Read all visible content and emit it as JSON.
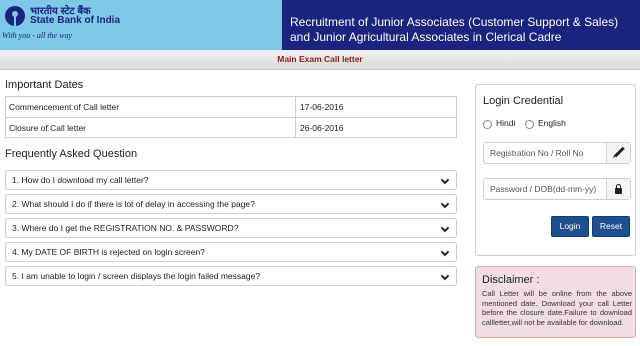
{
  "header": {
    "logo_hindi": "भारतीय स्टेट बैंक",
    "logo_english": "State Bank of India",
    "logo_tagline": "With you - all the way",
    "title": "Recruitment of Junior Associates (Customer Support & Sales) and Junior Agricultural Associates in Clerical Cadre"
  },
  "subbar": {
    "label": "Main Exam Call letter"
  },
  "important_dates": {
    "heading": "Important Dates",
    "rows": [
      {
        "label": "Commencement of Call letter",
        "value": "17-06-2016"
      },
      {
        "label": "Closure of Call letter",
        "value": "26-06-2016"
      }
    ]
  },
  "faq": {
    "heading": "Frequently Asked Question",
    "items": [
      "1. How do I download my call letter?",
      "2. What should I do if there is lot of delay in accessing the page?",
      "3. Where do I get the REGISTRATION NO. & PASSWORD?",
      "4. My DATE OF BIRTH is rejected on login screen?",
      "5. I am unable to login / screen displays the login failed message?"
    ]
  },
  "login": {
    "title": "Login Credential",
    "language_options": [
      "Hindi",
      "English"
    ],
    "registration_placeholder": "Registration No / Roll No",
    "password_placeholder": "Password / DOB(dd-mm-yy)",
    "login_label": "Login",
    "reset_label": "Reset"
  },
  "disclaimer": {
    "title": "Disclaimer :",
    "text": "Call Letter will be online from the above mentioned date. Download your call Letter before the closure date.Failure to download callletter,will not be available for download."
  },
  "colors": {
    "header_bg": "#1a237e",
    "logo_bg": "#7ec8e8",
    "subbar_text": "#8b1a1a",
    "button_bg": "#1e4f8f",
    "disclaimer_bg": "#f2dede"
  }
}
